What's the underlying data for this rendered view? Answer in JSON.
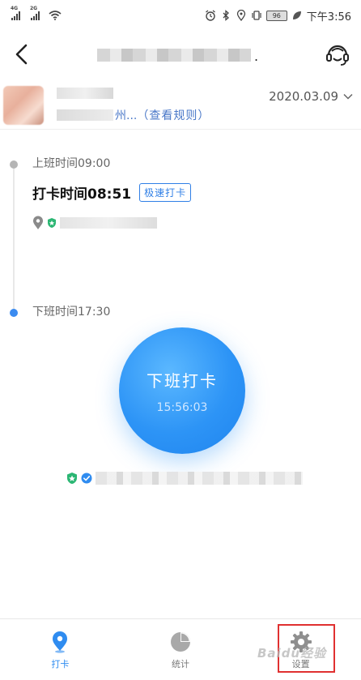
{
  "status_bar": {
    "signal_1_label": "4G",
    "signal_2_label": "2G",
    "battery": "96",
    "time": "下午3:56"
  },
  "header": {
    "title_suffix": "."
  },
  "user": {
    "group_suffix": "州...",
    "rules_link": "（查看规则）",
    "date": "2020.03.09"
  },
  "shift_on": {
    "label": "上班时间09:00",
    "punch_label": "打卡时间08:51",
    "tag": "极速打卡"
  },
  "shift_off": {
    "label": "下班时间17:30"
  },
  "punch_button": {
    "label": "下班打卡",
    "clock": "15:56:03"
  },
  "tabs": [
    {
      "label": "打卡",
      "icon": "location-pin-icon",
      "active": true
    },
    {
      "label": "统计",
      "icon": "pie-chart-icon",
      "active": false
    },
    {
      "label": "设置",
      "icon": "gear-icon",
      "active": false
    }
  ],
  "colors": {
    "accent": "#2f8cf0",
    "highlight": "#e03030",
    "shield": "#2bb673"
  },
  "watermark": "Baidu经验"
}
